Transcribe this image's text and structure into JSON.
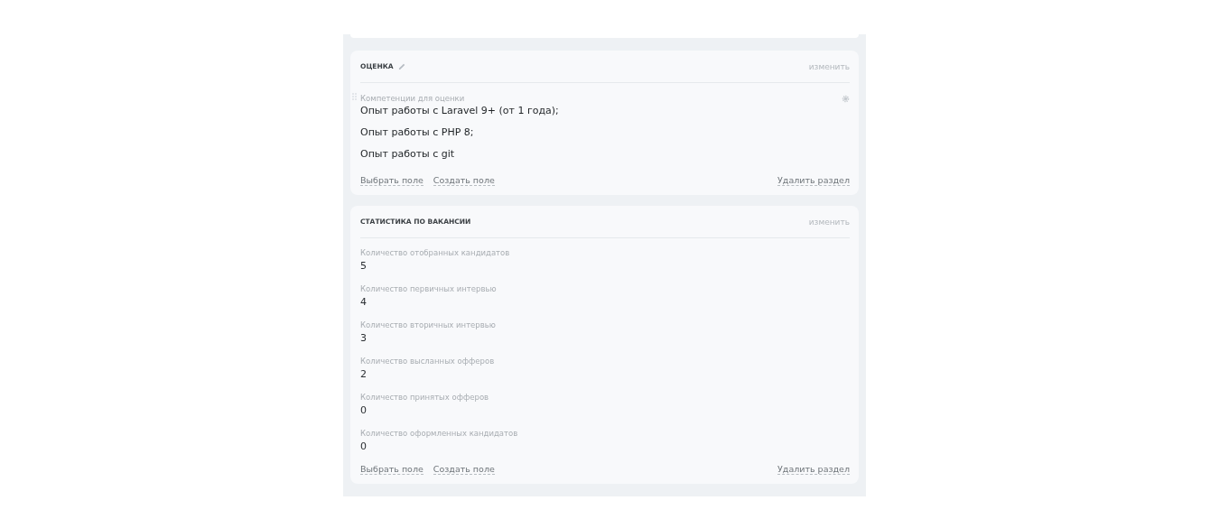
{
  "sections": [
    {
      "title": "ОЦЕНКА",
      "editable_title": true,
      "action": "изменить",
      "fields": [
        {
          "kind": "list",
          "label": "Компетенции для оценки",
          "draggable": true,
          "settings": true,
          "lines": [
            "Опыт работы с Laravel 9+ (от 1 года);",
            "Опыт работы с PHP 8;",
            "Опыт работы с git"
          ]
        }
      ],
      "footer": {
        "links": [
          "Выбрать поле",
          "Создать поле"
        ],
        "delete": "Удалить раздел"
      }
    },
    {
      "title": "СТАТИСТИКА ПО ВАКАНСИИ",
      "editable_title": false,
      "action": "изменить",
      "fields": [
        {
          "kind": "value",
          "label": "Количество отобранных кандидатов",
          "value": "5"
        },
        {
          "kind": "value",
          "label": "Количество первичных интервью",
          "value": "4"
        },
        {
          "kind": "value",
          "label": "Количество вторичных интервью",
          "value": "3"
        },
        {
          "kind": "value",
          "label": "Количество высланных офферов",
          "value": "2"
        },
        {
          "kind": "value",
          "label": "Количество принятых офферов",
          "value": "0"
        },
        {
          "kind": "value",
          "label": "Количество оформленных кандидатов",
          "value": "0"
        }
      ],
      "footer": {
        "links": [
          "Выбрать поле",
          "Создать поле"
        ],
        "delete": "Удалить раздел"
      }
    }
  ]
}
